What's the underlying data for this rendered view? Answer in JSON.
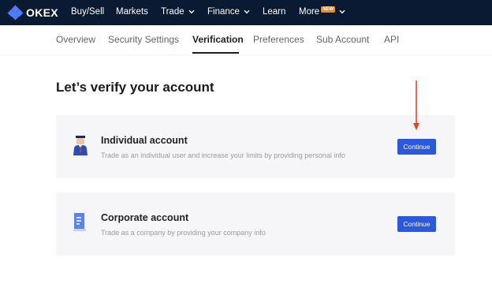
{
  "brand": {
    "name": "OKEX"
  },
  "nav": {
    "items": [
      {
        "label": "Buy/Sell",
        "dropdown": false
      },
      {
        "label": "Markets",
        "dropdown": false
      },
      {
        "label": "Trade",
        "dropdown": true
      },
      {
        "label": "Finance",
        "dropdown": true
      },
      {
        "label": "Learn",
        "dropdown": false
      },
      {
        "label": "More",
        "dropdown": true,
        "badge": "NEW"
      }
    ]
  },
  "tabs": {
    "items": [
      {
        "label": "Overview",
        "active": false
      },
      {
        "label": "Security Settings",
        "active": false
      },
      {
        "label": "Verification",
        "active": true
      },
      {
        "label": "Preferences",
        "active": false
      },
      {
        "label": "Sub Account",
        "active": false
      },
      {
        "label": "API",
        "active": false
      }
    ]
  },
  "page": {
    "title": "Let’s verify your account"
  },
  "cards": [
    {
      "icon": "person-icon",
      "title": "Individual account",
      "description": "Trade as an individual user and increase your limits by providing personal info",
      "button": "Continue"
    },
    {
      "icon": "building-icon",
      "title": "Corporate account",
      "description": "Trade as a company by providing your company info",
      "button": "Continue"
    }
  ],
  "annotation": {
    "icon": "arrow-down-icon",
    "color": "#d9472b"
  },
  "colors": {
    "topbar": "#0a1a33",
    "accent": "#2b59d9",
    "card_bg": "#f6f6f8",
    "new_badge": "#f08a1a"
  }
}
